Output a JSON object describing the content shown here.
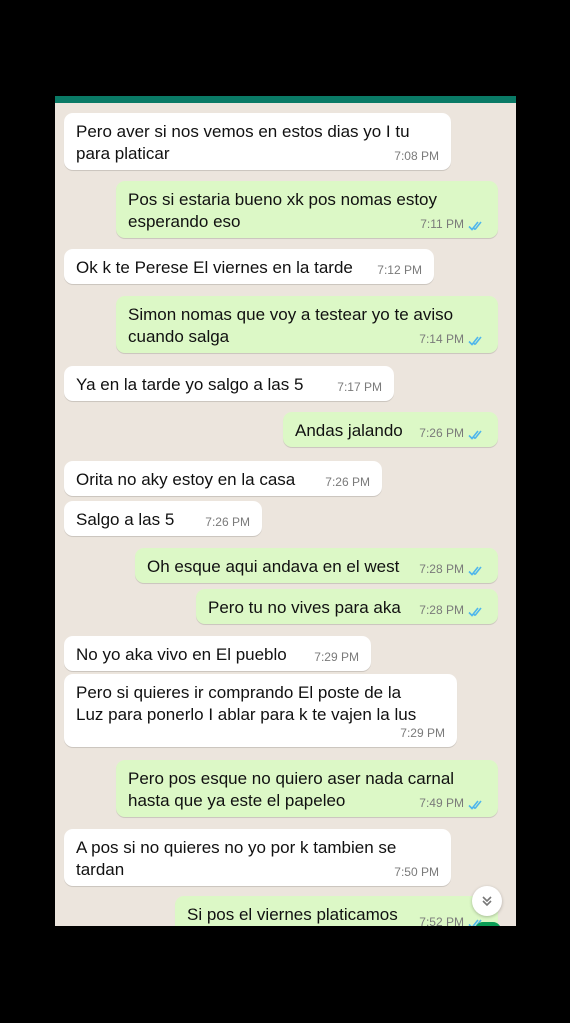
{
  "messages": [
    {
      "dir": "in",
      "text": "Pero aver si nos vemos en estos dias yo I tu\npara platicar",
      "time": "7:08 PM"
    },
    {
      "dir": "out",
      "text": "Pos si estaria bueno xk pos nomas estoy\nesperando eso",
      "time": "7:11 PM"
    },
    {
      "dir": "in",
      "text": "Ok k te Perese El viernes en la tarde",
      "time": "7:12 PM"
    },
    {
      "dir": "out",
      "text": "Simon nomas que voy a testear yo te aviso\ncuando salga",
      "time": "7:14 PM"
    },
    {
      "dir": "in",
      "text": "Ya en la tarde yo salgo a las 5",
      "time": "7:17 PM"
    },
    {
      "dir": "out",
      "text": "Andas jalando",
      "time": "7:26 PM"
    },
    {
      "dir": "in",
      "text": "Orita no aky estoy en la casa",
      "time": "7:26 PM"
    },
    {
      "dir": "in",
      "text": "Salgo a las 5",
      "time": "7:26 PM"
    },
    {
      "dir": "out",
      "text": "Oh esque aqui andava en el west",
      "time": "7:28 PM"
    },
    {
      "dir": "out",
      "text": "Pero tu no vives para aka",
      "time": "7:28 PM"
    },
    {
      "dir": "in",
      "text": "No yo aka vivo en El pueblo",
      "time": "7:29 PM"
    },
    {
      "dir": "in",
      "text": "Pero si quieres ir comprando El poste de la\nLuz para ponerlo I ablar para k te vajen la lus",
      "time": "7:29 PM"
    },
    {
      "dir": "out",
      "text": "Pero pos esque no quiero aser nada carnal\nhasta que ya este el papeleo",
      "time": "7:49 PM"
    },
    {
      "dir": "in",
      "text": "A pos si no quieres no yo por k tambien se\ntardan",
      "time": "7:50 PM"
    },
    {
      "dir": "out",
      "text": "Si pos el viernes platicamos",
      "time": "7:52 PM"
    }
  ],
  "colors": {
    "incoming": "#ffffff",
    "outgoing": "#dcf8c6",
    "read_ticks": "#4fb6ec",
    "background": "#ece5dd",
    "header": "#0a7a66"
  },
  "icons": {
    "scroll_down": "double-chevron-down-icon",
    "read_receipt": "double-check-icon"
  }
}
